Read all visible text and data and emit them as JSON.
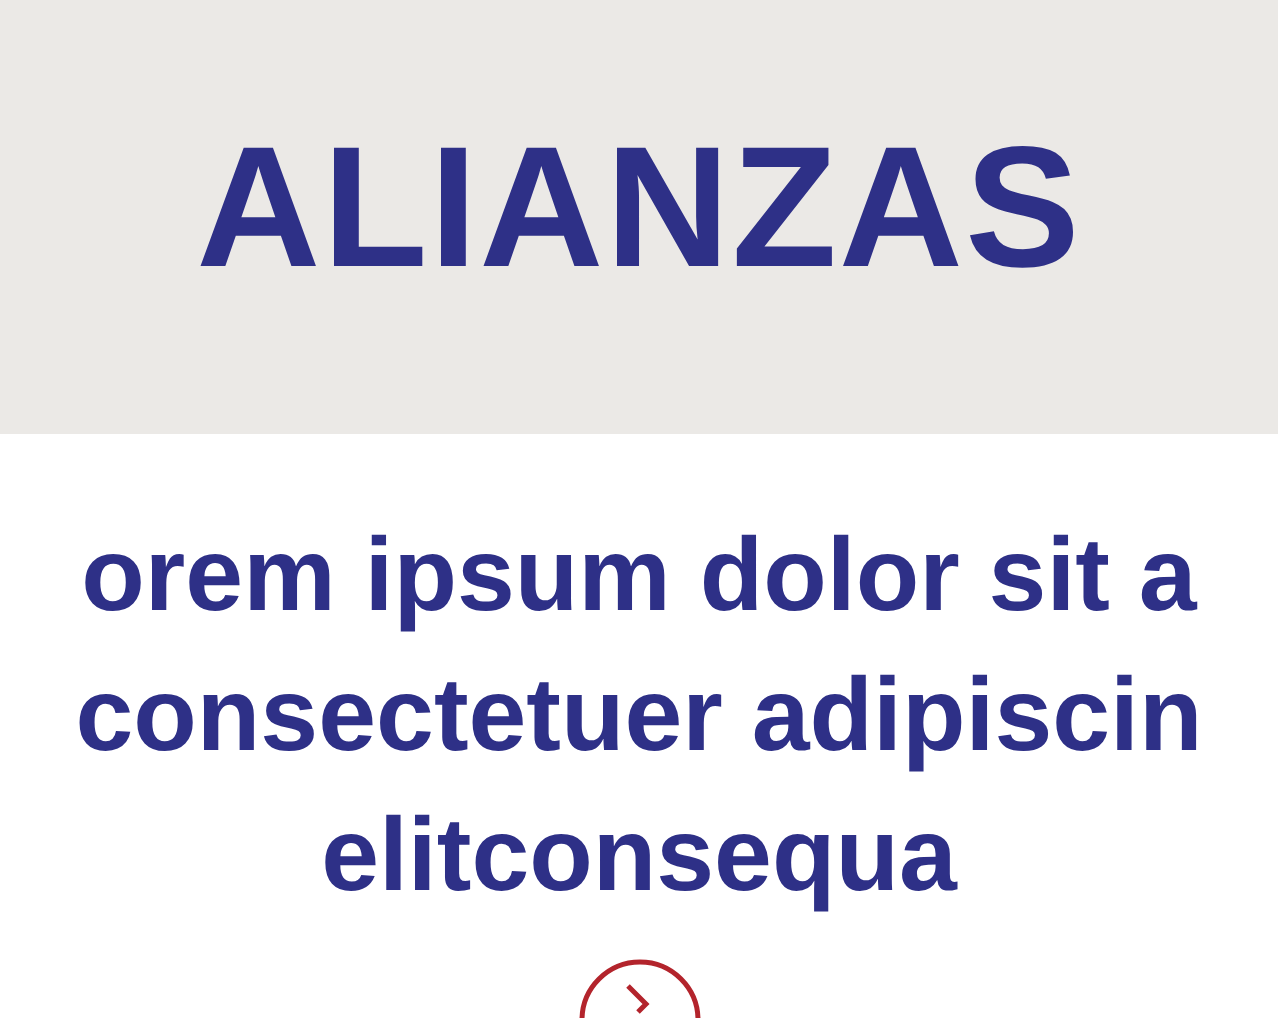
{
  "header": {
    "title": "ALIANZAS"
  },
  "intro": {
    "text": "orem ipsum dolor sit a\nconsectetuer adipiscin\nelitconsequa"
  }
}
